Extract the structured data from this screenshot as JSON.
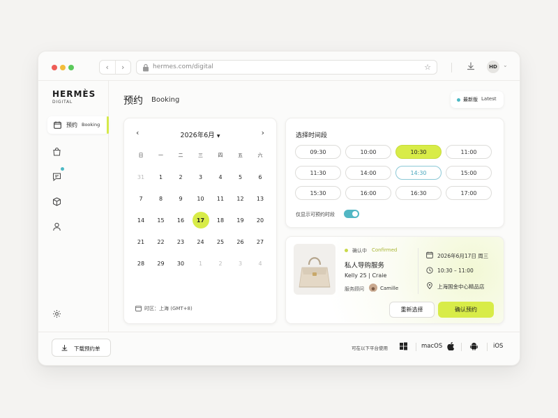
{
  "browser": {
    "url": "hermes.com/digital",
    "avatar_initials": "HD"
  },
  "brand": {
    "name": "HERMÈS",
    "sub": "DIGITAL"
  },
  "sidebar": {
    "active_label_cn": "预约",
    "active_label_en": "Booking"
  },
  "header": {
    "title": "预约",
    "subtitle": "Booking",
    "latest_cn": "最新版",
    "latest_en": "Latest"
  },
  "calendar": {
    "month_label": "2026年6月",
    "weekdays": [
      "日",
      "一",
      "二",
      "三",
      "四",
      "五",
      "六"
    ],
    "weeks": [
      [
        "31",
        "1",
        "2",
        "3",
        "4",
        "5",
        "6"
      ],
      [
        "7",
        "8",
        "9",
        "10",
        "11",
        "12",
        "13"
      ],
      [
        "14",
        "15",
        "16",
        "17",
        "18",
        "19",
        "20"
      ],
      [
        "21",
        "22",
        "23",
        "24",
        "25",
        "26",
        "27"
      ],
      [
        "28",
        "29",
        "30",
        "1",
        "2",
        "3",
        "4"
      ]
    ],
    "selected": "17",
    "timezone": "时区：上海 (GMT+8)"
  },
  "timeslots": {
    "title": "选择时间段",
    "slots": [
      "09:30",
      "10:00",
      "10:30",
      "11:00",
      "11:30",
      "14:00",
      "14:30",
      "15:00",
      "15:30",
      "16:00",
      "16:30",
      "17:00"
    ],
    "selected": "10:30",
    "hovered": "14:30",
    "only_available_label": "仅显示可预约时段",
    "only_available": true
  },
  "booking": {
    "status_cn": "确认中",
    "status_en": "Confirmed",
    "service": "私人导购服务",
    "product": "Kelly 25 | Craie",
    "advisor_label": "服务顾问",
    "advisor_name": "Camille",
    "date": "2026年6月17日  周三",
    "time": "10:30 – 11:00",
    "location": "上海国金中心精品店",
    "reset_label": "重新选择",
    "confirm_label": "确认预约"
  },
  "footer": {
    "download_label": "下载预约单",
    "platforms_label": "可在以下平台使用",
    "macos": "macOS",
    "ios": "iOS"
  },
  "colors": {
    "accent": "#d8ec48",
    "teal": "#52b7c4"
  }
}
